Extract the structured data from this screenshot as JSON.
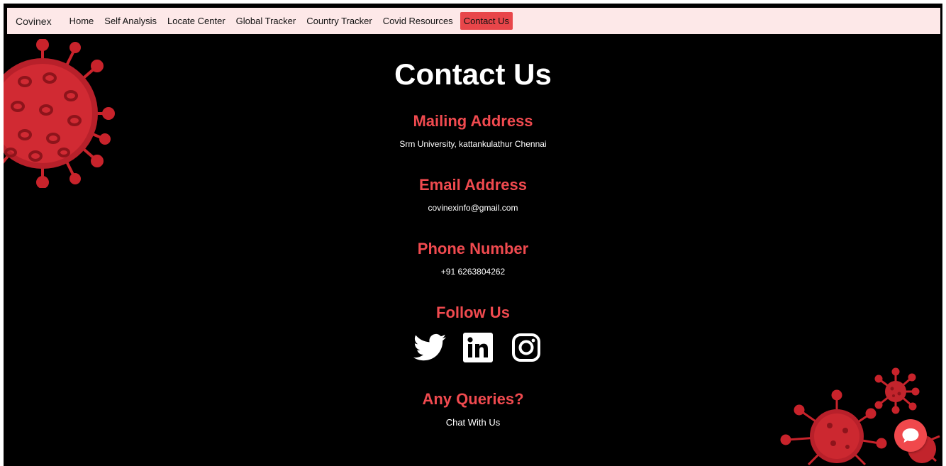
{
  "nav": {
    "brand": "Covinex",
    "links": [
      "Home",
      "Self Analysis",
      "Locate Center",
      "Global Tracker",
      "Country Tracker",
      "Covid Resources",
      "Contact Us"
    ],
    "active": "Contact Us"
  },
  "main": {
    "title": "Contact Us",
    "mailing": {
      "heading": "Mailing Address",
      "text": "Srm University, kattankulathur Chennai"
    },
    "email": {
      "heading": "Email Address",
      "text": "covinexinfo@gmail.com"
    },
    "phone": {
      "heading": "Phone Number",
      "text": "+91 6263804262"
    },
    "follow": {
      "heading": "Follow Us",
      "icons": [
        "twitter-icon",
        "linkedin-icon",
        "instagram-icon"
      ]
    },
    "queries": {
      "heading": "Any Queries?",
      "text": "Chat With Us"
    }
  },
  "colors": {
    "accent": "#f04a4f",
    "navbar_bg": "#fde8e8",
    "page_bg": "#000000",
    "virus": "#c8232b"
  }
}
